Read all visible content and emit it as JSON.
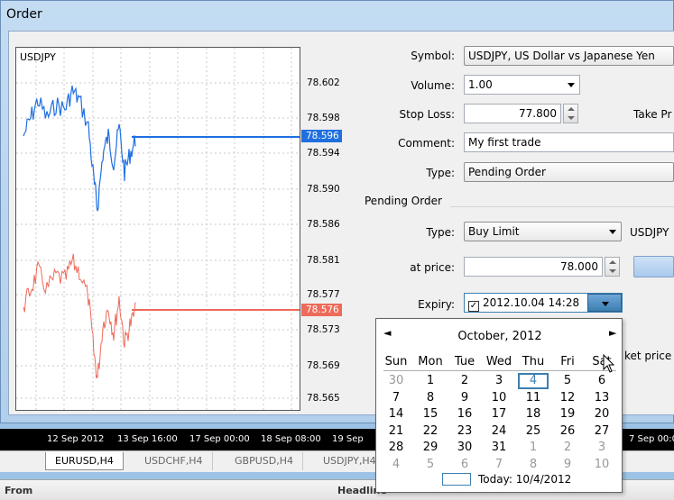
{
  "window": {
    "title": "Order"
  },
  "chart": {
    "symbol": "USDJPY",
    "price_levels": [
      "78.602",
      "78.598",
      "78.594",
      "78.590",
      "78.586",
      "78.581",
      "78.577",
      "78.573",
      "78.569",
      "78.565"
    ],
    "ask_price": "78.596",
    "bid_price": "78.576",
    "ask_color": "#1f6fe0",
    "bid_color": "#ee6a5a"
  },
  "form": {
    "symbol_label": "Symbol:",
    "symbol_value": "USDJPY, US Dollar vs Japanese Yen",
    "volume_label": "Volume:",
    "volume_value": "1.00",
    "stop_loss_label": "Stop Loss:",
    "stop_loss_value": "77.800",
    "take_profit_label": "Take Pr",
    "comment_label": "Comment:",
    "comment_value": "My first trade",
    "type_label": "Type:",
    "type_value": "Pending Order",
    "pending_group_label": "Pending Order",
    "pending_type_label": "Type:",
    "pending_type_value": "Buy Limit",
    "pending_symbol": "USDJPY",
    "at_price_label": "at price:",
    "at_price_value": "78.000",
    "expiry_label": "Expiry:",
    "expiry_value": "2012.10.04 14:28",
    "market_price_partial": "ket price l"
  },
  "calendar": {
    "month": "October, 2012",
    "prev": "◄",
    "next": "►",
    "weekdays": [
      "Sun",
      "Mon",
      "Tue",
      "Wed",
      "Thu",
      "Fri",
      "Sat"
    ],
    "weeks": [
      [
        "30",
        "1",
        "2",
        "3",
        "4",
        "5",
        "6"
      ],
      [
        "7",
        "8",
        "9",
        "10",
        "11",
        "12",
        "13"
      ],
      [
        "14",
        "15",
        "16",
        "17",
        "18",
        "19",
        "20"
      ],
      [
        "21",
        "22",
        "23",
        "24",
        "25",
        "26",
        "27"
      ],
      [
        "28",
        "29",
        "30",
        "31",
        "1",
        "2",
        "3"
      ],
      [
        "4",
        "5",
        "6",
        "7",
        "8",
        "9",
        "10"
      ]
    ],
    "today_label": "Today: 10/4/2012"
  },
  "background": {
    "time_labels": [
      "12 Sep 2012",
      "13 Sep 16:00",
      "17 Sep 00:00",
      "18 Sep 08:00",
      "19 Sep",
      "7 Sep 00:00"
    ],
    "tabs": [
      "EURUSD,H4",
      "USDCHF,H4",
      "GBPUSD,H4",
      "USDJPY,H4"
    ],
    "footer_from": "From",
    "footer_headline": "Headline"
  }
}
